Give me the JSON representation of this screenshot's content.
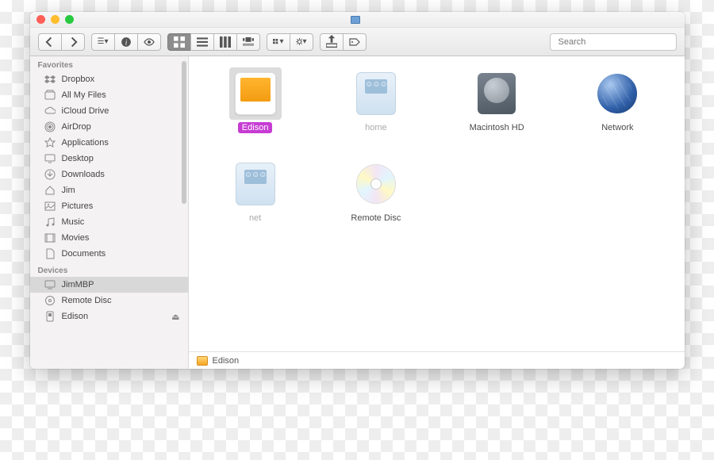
{
  "window": {
    "title": ""
  },
  "toolbar": {
    "search_placeholder": "Search"
  },
  "sidebar": {
    "sections": [
      {
        "label": "Favorites",
        "items": [
          {
            "label": "Dropbox",
            "icon": "dropbox"
          },
          {
            "label": "All My Files",
            "icon": "allfiles"
          },
          {
            "label": "iCloud Drive",
            "icon": "icloud"
          },
          {
            "label": "AirDrop",
            "icon": "airdrop"
          },
          {
            "label": "Applications",
            "icon": "apps"
          },
          {
            "label": "Desktop",
            "icon": "desktop"
          },
          {
            "label": "Downloads",
            "icon": "downloads"
          },
          {
            "label": "Jim",
            "icon": "home"
          },
          {
            "label": "Pictures",
            "icon": "pictures"
          },
          {
            "label": "Music",
            "icon": "music"
          },
          {
            "label": "Movies",
            "icon": "movies"
          },
          {
            "label": "Documents",
            "icon": "documents"
          }
        ]
      },
      {
        "label": "Devices",
        "items": [
          {
            "label": "JimMBP",
            "icon": "computer",
            "selected": true
          },
          {
            "label": "Remote Disc",
            "icon": "disc"
          },
          {
            "label": "Edison",
            "icon": "ext",
            "ejectable": true
          }
        ]
      }
    ]
  },
  "content": {
    "items": [
      {
        "label": "Edison",
        "type": "ext",
        "selected": true
      },
      {
        "label": "home",
        "type": "srv",
        "dim": true
      },
      {
        "label": "Macintosh HD",
        "type": "hd"
      },
      {
        "label": "Network",
        "type": "net"
      },
      {
        "label": "net",
        "type": "srv",
        "dim": true
      },
      {
        "label": "Remote Disc",
        "type": "cd"
      }
    ]
  },
  "pathbar": {
    "location": "Edison"
  }
}
